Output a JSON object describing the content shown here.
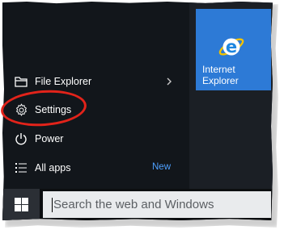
{
  "tile": {
    "label": "Internet Explorer",
    "color": "#2d7ad6",
    "icon": "internet-explorer-icon"
  },
  "menu": {
    "items": [
      {
        "label": "File Explorer",
        "icon": "folder-icon",
        "has_submenu": true
      },
      {
        "label": "Settings",
        "icon": "gear-icon"
      },
      {
        "label": "Power",
        "icon": "power-icon"
      },
      {
        "label": "All apps",
        "icon": "list-icon",
        "badge": "New"
      }
    ]
  },
  "taskbar": {
    "start_icon": "windows-logo-icon",
    "search_text": "Search the web and Windows"
  },
  "annotation": {
    "color": "#e2231a",
    "target": "Settings"
  }
}
